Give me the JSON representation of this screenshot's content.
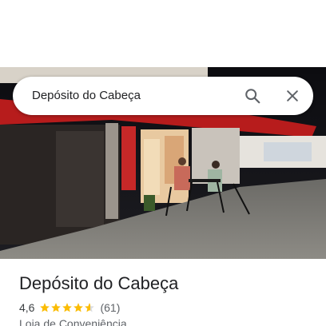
{
  "search": {
    "query": "Depósito do Cabeça"
  },
  "place": {
    "name": "Depósito do Cabeça",
    "rating": "4,6",
    "rating_value": 4.6,
    "rating_max": 5,
    "review_count": "(61)",
    "category": "Loja de Conveniência"
  },
  "colors": {
    "star": "#fbbc04",
    "star_empty": "#dadce0",
    "title": "#202124",
    "secondary": "#5f6368",
    "icon": "#5f6368"
  },
  "icons": {
    "search": "search-icon",
    "close": "close-icon"
  }
}
